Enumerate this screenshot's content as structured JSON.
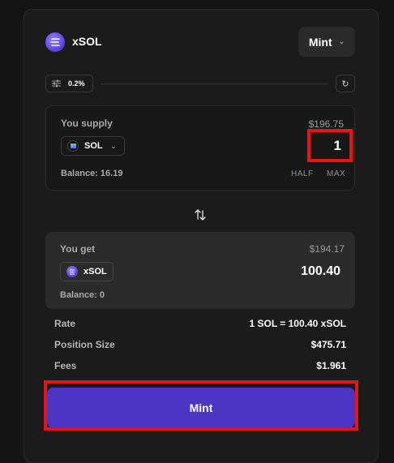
{
  "header": {
    "token_name": "xSOL",
    "mode_label": "Mint"
  },
  "slippage": {
    "value": "0.2%"
  },
  "supply": {
    "label": "You supply",
    "usd_value": "$196.75",
    "token": "SOL",
    "amount": "1",
    "balance": "Balance: 16.19",
    "half_label": "HALF",
    "max_label": "MAX"
  },
  "receive": {
    "label": "You get",
    "usd_value": "$194.17",
    "token": "xSOL",
    "amount": "100.40",
    "balance": "Balance: 0"
  },
  "details": [
    {
      "label": "Rate",
      "value": "1 SOL = 100.40 xSOL"
    },
    {
      "label": "Position Size",
      "value": "$475.71"
    },
    {
      "label": "Fees",
      "value": "$1.961"
    }
  ],
  "action": {
    "mint_label": "Mint"
  },
  "colors": {
    "accent": "#4c35c3",
    "highlight": "#e8141c"
  }
}
